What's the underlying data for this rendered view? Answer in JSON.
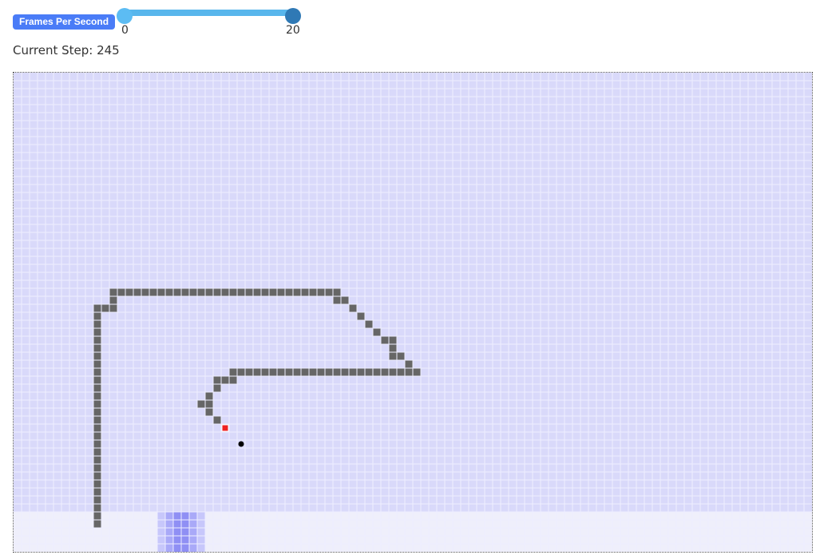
{
  "controls": {
    "fps_label": "Frames Per Second",
    "fps_min_label": "0",
    "fps_max_label": "20",
    "fps_min": 0,
    "fps_max": 20,
    "fps_value": 20
  },
  "status": {
    "step_prefix": "Current Step:",
    "step_value": "245"
  },
  "grid": {
    "cols": 100,
    "rows": 60,
    "colors": {
      "upper_bg": "#d9d9fa",
      "lower_bg": "#efeffb",
      "grid_line": "#eeeeff",
      "wall": "#666666",
      "current": "#ee2222",
      "goal": "#000000",
      "blue_light": "#c7c7fb",
      "blue_mid": "#a9a9f8",
      "blue_dark": "#8f8ff4"
    },
    "lower_region_start_row": 55,
    "goal_cell": [
      28,
      46
    ],
    "current_cell": [
      26,
      44
    ],
    "wall_cells": [
      [
        12,
        27
      ],
      [
        13,
        27
      ],
      [
        14,
        27
      ],
      [
        15,
        27
      ],
      [
        16,
        27
      ],
      [
        17,
        27
      ],
      [
        18,
        27
      ],
      [
        19,
        27
      ],
      [
        20,
        27
      ],
      [
        21,
        27
      ],
      [
        22,
        27
      ],
      [
        23,
        27
      ],
      [
        24,
        27
      ],
      [
        25,
        27
      ],
      [
        26,
        27
      ],
      [
        27,
        27
      ],
      [
        28,
        27
      ],
      [
        29,
        27
      ],
      [
        30,
        27
      ],
      [
        31,
        27
      ],
      [
        32,
        27
      ],
      [
        33,
        27
      ],
      [
        34,
        27
      ],
      [
        35,
        27
      ],
      [
        36,
        27
      ],
      [
        37,
        27
      ],
      [
        38,
        27
      ],
      [
        39,
        27
      ],
      [
        40,
        27
      ],
      [
        12,
        28
      ],
      [
        40,
        28
      ],
      [
        41,
        28
      ],
      [
        10,
        29
      ],
      [
        11,
        29
      ],
      [
        12,
        29
      ],
      [
        42,
        29
      ],
      [
        10,
        30
      ],
      [
        43,
        30
      ],
      [
        10,
        31
      ],
      [
        44,
        31
      ],
      [
        10,
        32
      ],
      [
        45,
        32
      ],
      [
        10,
        33
      ],
      [
        46,
        33
      ],
      [
        47,
        33
      ],
      [
        10,
        34
      ],
      [
        47,
        34
      ],
      [
        10,
        35
      ],
      [
        47,
        35
      ],
      [
        48,
        35
      ],
      [
        10,
        36
      ],
      [
        49,
        36
      ],
      [
        10,
        37
      ],
      [
        27,
        37
      ],
      [
        28,
        37
      ],
      [
        29,
        37
      ],
      [
        30,
        37
      ],
      [
        31,
        37
      ],
      [
        32,
        37
      ],
      [
        33,
        37
      ],
      [
        34,
        37
      ],
      [
        35,
        37
      ],
      [
        36,
        37
      ],
      [
        37,
        37
      ],
      [
        38,
        37
      ],
      [
        39,
        37
      ],
      [
        40,
        37
      ],
      [
        41,
        37
      ],
      [
        42,
        37
      ],
      [
        43,
        37
      ],
      [
        44,
        37
      ],
      [
        45,
        37
      ],
      [
        46,
        37
      ],
      [
        47,
        37
      ],
      [
        48,
        37
      ],
      [
        49,
        37
      ],
      [
        50,
        37
      ],
      [
        10,
        38
      ],
      [
        25,
        38
      ],
      [
        26,
        38
      ],
      [
        27,
        38
      ],
      [
        10,
        39
      ],
      [
        25,
        39
      ],
      [
        10,
        40
      ],
      [
        24,
        40
      ],
      [
        10,
        41
      ],
      [
        23,
        41
      ],
      [
        24,
        41
      ],
      [
        10,
        42
      ],
      [
        24,
        42
      ],
      [
        10,
        43
      ],
      [
        25,
        43
      ],
      [
        10,
        44
      ],
      [
        10,
        45
      ],
      [
        10,
        46
      ],
      [
        10,
        47
      ],
      [
        10,
        48
      ],
      [
        10,
        49
      ],
      [
        10,
        50
      ],
      [
        10,
        51
      ],
      [
        10,
        52
      ],
      [
        10,
        53
      ],
      [
        10,
        54
      ],
      [
        10,
        55
      ],
      [
        10,
        56
      ]
    ],
    "blue_patch": [
      [
        18,
        55,
        "l"
      ],
      [
        19,
        55,
        "m"
      ],
      [
        20,
        55,
        "d"
      ],
      [
        21,
        55,
        "d"
      ],
      [
        22,
        55,
        "m"
      ],
      [
        23,
        55,
        "l"
      ],
      [
        18,
        56,
        "l"
      ],
      [
        19,
        56,
        "m"
      ],
      [
        20,
        56,
        "d"
      ],
      [
        21,
        56,
        "d"
      ],
      [
        22,
        56,
        "m"
      ],
      [
        23,
        56,
        "l"
      ],
      [
        18,
        57,
        "l"
      ],
      [
        19,
        57,
        "m"
      ],
      [
        20,
        57,
        "d"
      ],
      [
        21,
        57,
        "d"
      ],
      [
        22,
        57,
        "m"
      ],
      [
        23,
        57,
        "l"
      ],
      [
        18,
        58,
        "l"
      ],
      [
        19,
        58,
        "m"
      ],
      [
        20,
        58,
        "d"
      ],
      [
        21,
        58,
        "d"
      ],
      [
        22,
        58,
        "m"
      ],
      [
        23,
        58,
        "l"
      ],
      [
        18,
        59,
        "l"
      ],
      [
        19,
        59,
        "m"
      ],
      [
        20,
        59,
        "d"
      ],
      [
        21,
        59,
        "d"
      ],
      [
        22,
        59,
        "m"
      ],
      [
        23,
        59,
        "l"
      ]
    ]
  }
}
